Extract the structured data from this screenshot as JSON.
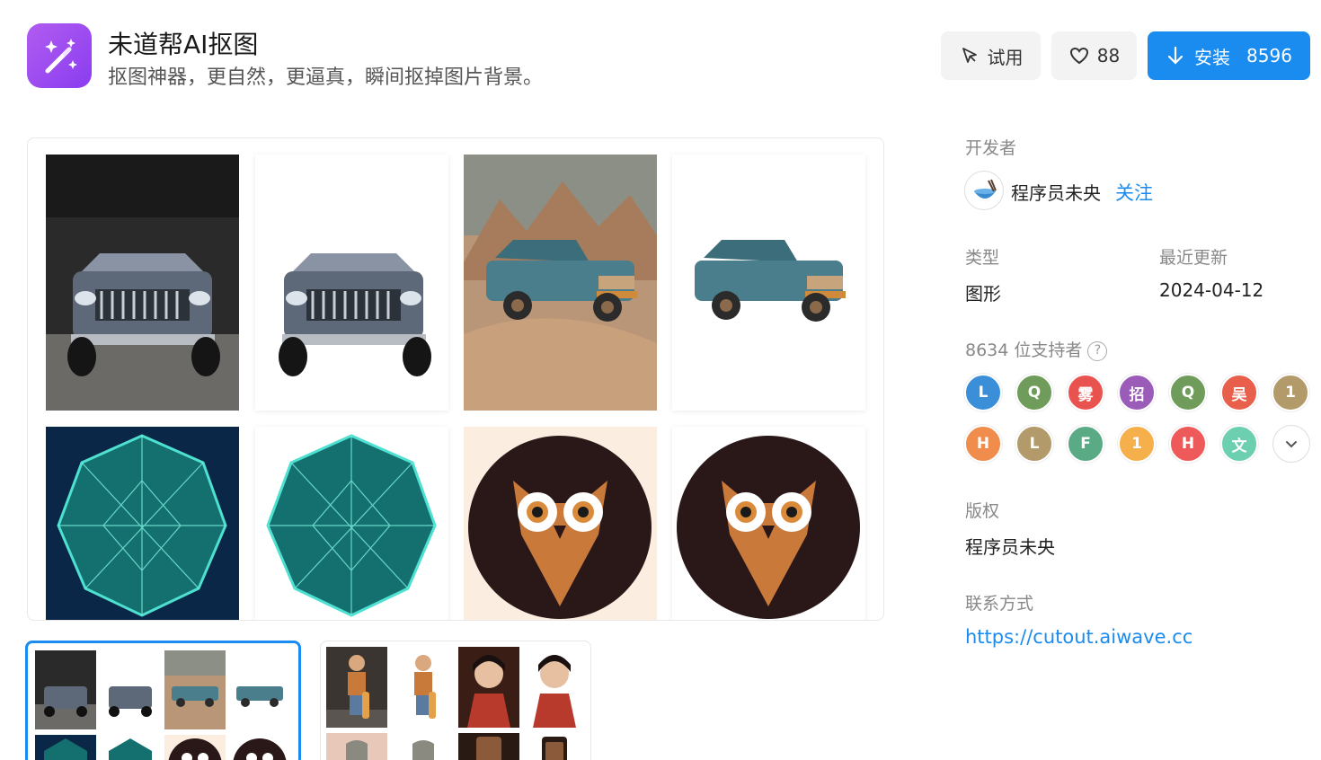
{
  "app": {
    "title": "未道帮AI抠图",
    "subtitle": "抠图神器，更自然，更逼真，瞬间抠掉图片背景。",
    "icon": "magic-wand-icon",
    "accent_color": "#9b4cf0"
  },
  "actions": {
    "try_label": "试用",
    "like_count": "88",
    "install_label": "安装",
    "install_count": "8596",
    "brand_color": "#1a8cf0"
  },
  "preview": {
    "images": [
      "jeep-original",
      "jeep-cutout",
      "wagon-original",
      "wagon-cutout",
      "crystal-original",
      "crystal-cutout",
      "owl-original",
      "owl-cutout"
    ]
  },
  "thumbnails": [
    "vehicles-and-icons-set",
    "kids-set"
  ],
  "sidebar": {
    "developer_label": "开发者",
    "developer_name": "程序员未央",
    "follow_label": "关注",
    "type_label": "类型",
    "type_value": "图形",
    "updated_label": "最近更新",
    "updated_value": "2024-04-12",
    "supporters_label": "8634 位支持者",
    "help_icon": "?",
    "supporters": [
      {
        "text": "L",
        "color": "#3b8fd9"
      },
      {
        "text": "Q",
        "color": "#6f9c5a"
      },
      {
        "text": "雾",
        "color": "#e8524f"
      },
      {
        "text": "招",
        "color": "#9b5bb8"
      },
      {
        "text": "Q",
        "color": "#6f9c5a"
      },
      {
        "text": "吴",
        "color": "#e8604c"
      },
      {
        "text": "1",
        "color": "#b29a6a"
      },
      {
        "text": "H",
        "color": "#f08c4c"
      },
      {
        "text": "L",
        "color": "#b29a6a"
      },
      {
        "text": "F",
        "color": "#5aab85"
      },
      {
        "text": "1",
        "color": "#f5b04c"
      },
      {
        "text": "H",
        "color": "#ee5a5a"
      },
      {
        "text": "文",
        "color": "#6cd0b0"
      }
    ],
    "copyright_label": "版权",
    "copyright_value": "程序员未央",
    "contact_label": "联系方式",
    "contact_url": "https://cutout.aiwave.cc"
  }
}
